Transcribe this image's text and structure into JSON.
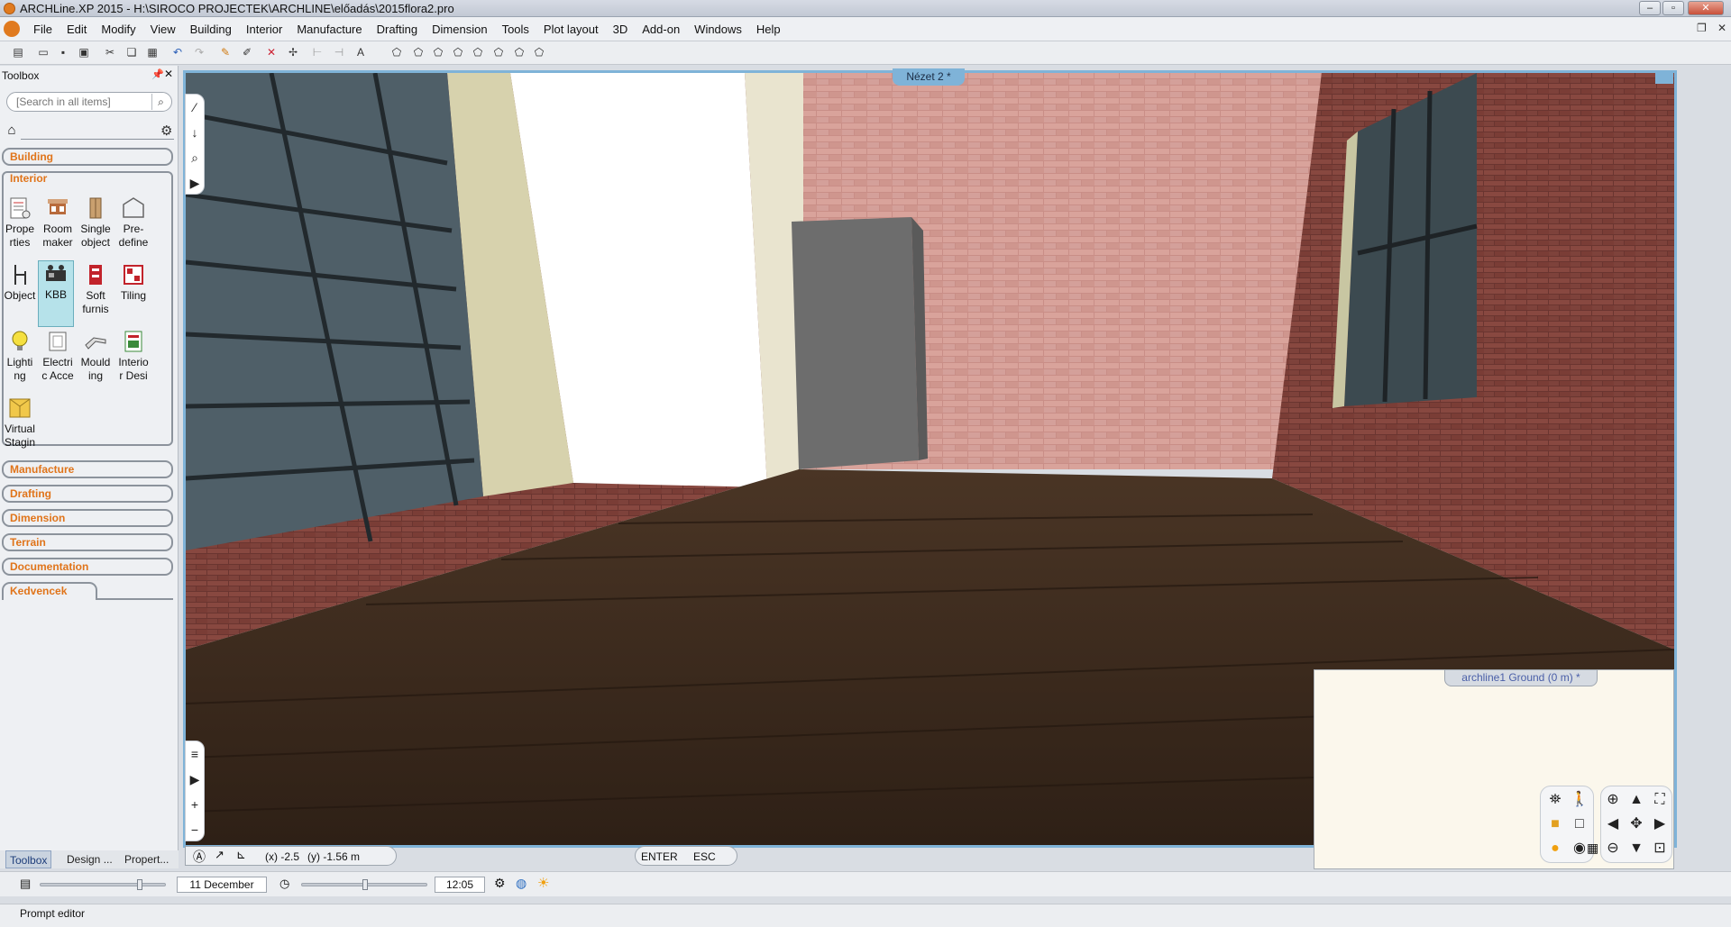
{
  "window": {
    "title": "ARCHLine.XP 2015 - H:\\SIROCO PROJECTEK\\ARCHLINE\\előadás\\2015flora2.pro",
    "controls": [
      "–",
      "▫",
      "✕"
    ]
  },
  "menu": {
    "items": [
      "File",
      "Edit",
      "Modify",
      "View",
      "Building",
      "Interior",
      "Manufacture",
      "Drafting",
      "Dimension",
      "Tools",
      "Plot layout",
      "3D",
      "Add-on",
      "Windows",
      "Help"
    ]
  },
  "toolbox": {
    "title": "Toolbox",
    "search_placeholder": "[Search in all items]",
    "categories": {
      "building": "Building",
      "interior": "Interior",
      "manufacture": "Manufacture",
      "drafting": "Drafting",
      "dimension": "Dimension",
      "terrain": "Terrain",
      "documentation": "Documentation",
      "kedvencek": "Kedvencek"
    },
    "tools": [
      {
        "label": "Prope rties"
      },
      {
        "label": "Room maker"
      },
      {
        "label": "Single object"
      },
      {
        "label": "Pre- define"
      },
      {
        "label": "Object"
      },
      {
        "label": "KBB"
      },
      {
        "label": "Soft furnis"
      },
      {
        "label": "Tiling"
      },
      {
        "label": "Lighti ng"
      },
      {
        "label": "Electri c Acce"
      },
      {
        "label": "Mould ing"
      },
      {
        "label": "Interio r Desi"
      },
      {
        "label": "Virtual Stagin"
      }
    ],
    "bottom_tabs": [
      "Toolbox",
      "Design ...",
      "Propert..."
    ]
  },
  "viewport": {
    "tab_title": "Nézet 2 *",
    "coord_x": "(x) -2.5",
    "coord_y": "(y) -1.56 m",
    "enter": "ENTER",
    "esc": "ESC"
  },
  "floorplan": {
    "tab_title": "archline1 Ground (0 m) *"
  },
  "statusbar": {
    "date": "11 December",
    "time": "12:05",
    "day_slider_fraction": 0.8,
    "time_slider_fraction": 0.5
  },
  "prompt": {
    "label": "Prompt editor"
  }
}
